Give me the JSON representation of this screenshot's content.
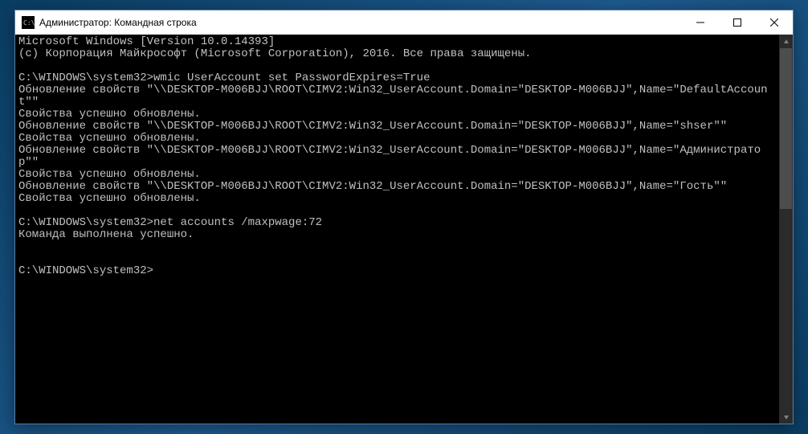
{
  "window": {
    "title": "Администратор: Командная строка"
  },
  "terminal": {
    "header_line1": "Microsoft Windows [Version 10.0.14393]",
    "header_line2": "(c) Корпорация Майкрософт (Microsoft Corporation), 2016. Все права защищены.",
    "prompt1": "C:\\WINDOWS\\system32>",
    "cmd1": "wmic UserAccount set PasswordExpires=True",
    "out1": "Обновление свойств \"\\\\DESKTOP-M006BJJ\\ROOT\\CIMV2:Win32_UserAccount.Domain=\"DESKTOP-M006BJJ\",Name=\"DefaultAccount\"\"",
    "out2": "Свойства успешно обновлены.",
    "out3": "Обновление свойств \"\\\\DESKTOP-M006BJJ\\ROOT\\CIMV2:Win32_UserAccount.Domain=\"DESKTOP-M006BJJ\",Name=\"shser\"\"",
    "out4": "Свойства успешно обновлены.",
    "out5": "Обновление свойств \"\\\\DESKTOP-M006BJJ\\ROOT\\CIMV2:Win32_UserAccount.Domain=\"DESKTOP-M006BJJ\",Name=\"Администратор\"\"",
    "out6": "Свойства успешно обновлены.",
    "out7": "Обновление свойств \"\\\\DESKTOP-M006BJJ\\ROOT\\CIMV2:Win32_UserAccount.Domain=\"DESKTOP-M006BJJ\",Name=\"Гость\"\"",
    "out8": "Свойства успешно обновлены.",
    "prompt2": "C:\\WINDOWS\\system32>",
    "cmd2": "net accounts /maxpwage:72",
    "out9": "Команда выполнена успешно.",
    "prompt3": "C:\\WINDOWS\\system32>"
  }
}
